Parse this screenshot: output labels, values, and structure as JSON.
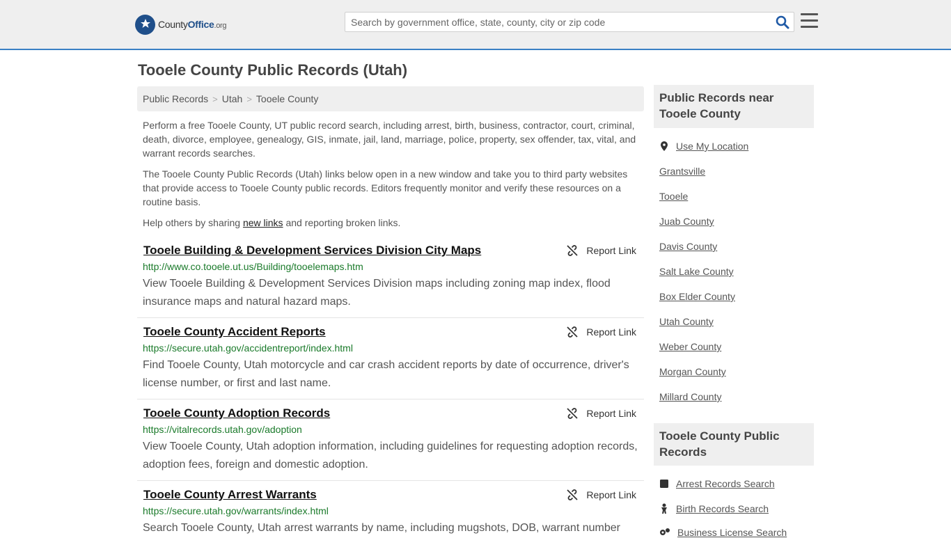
{
  "header": {
    "logo": {
      "part1": "County",
      "part2": "Office",
      "part3": ".org"
    },
    "search_placeholder": "Search by government office, state, county, city or zip code"
  },
  "page_title": "Tooele County Public Records (Utah)",
  "breadcrumb": [
    "Public Records",
    "Utah",
    "Tooele County"
  ],
  "intro": {
    "p1": "Perform a free Tooele County, UT public record search, including arrest, birth, business, contractor, court, criminal, death, divorce, employee, genealogy, GIS, inmate, jail, land, marriage, police, property, sex offender, tax, vital, and warrant records searches.",
    "p2": "The Tooele County Public Records (Utah) links below open in a new window and take you to third party websites that provide access to Tooele County public records. Editors frequently monitor and verify these resources on a routine basis.",
    "p3_before": "Help others by sharing ",
    "p3_link": "new links",
    "p3_after": " and reporting broken links."
  },
  "report_label": "Report Link",
  "records": [
    {
      "title": "Tooele Building & Development Services Division City Maps",
      "url": "http://www.co.tooele.ut.us/Building/tooelemaps.htm",
      "desc": "View Tooele Building & Development Services Division maps including zoning map index, flood insurance maps and natural hazard maps."
    },
    {
      "title": "Tooele County Accident Reports",
      "url": "https://secure.utah.gov/accidentreport/index.html",
      "desc": "Find Tooele County, Utah motorcycle and car crash accident reports by date of occurrence, driver's license number, or first and last name."
    },
    {
      "title": "Tooele County Adoption Records",
      "url": "https://vitalrecords.utah.gov/adoption",
      "desc": "View Tooele County, Utah adoption information, including guidelines for requesting adoption records, adoption fees, foreign and domestic adoption."
    },
    {
      "title": "Tooele County Arrest Warrants",
      "url": "https://secure.utah.gov/warrants/index.html",
      "desc": "Search Tooele County, Utah arrest warrants by name, including mugshots, DOB, warrant number"
    }
  ],
  "sidebar": {
    "nearby_title": "Public Records near Tooele County",
    "use_location": "Use My Location",
    "nearby": [
      "Grantsville",
      "Tooele",
      "Juab County",
      "Davis County",
      "Salt Lake County",
      "Box Elder County",
      "Utah County",
      "Weber County",
      "Morgan County",
      "Millard County"
    ],
    "county_title": "Tooele County Public Records",
    "county_links": [
      "Arrest Records Search",
      "Birth Records Search",
      "Business License Search"
    ]
  }
}
